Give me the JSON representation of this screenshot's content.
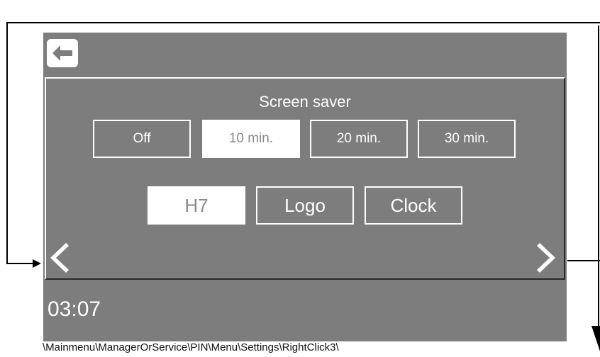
{
  "header": {
    "back_icon": "arrow-left-icon"
  },
  "panel": {
    "title": "Screen saver",
    "timer_options": [
      {
        "label": "Off",
        "selected": false
      },
      {
        "label": "10 min.",
        "selected": true
      },
      {
        "label": "20 min.",
        "selected": false
      },
      {
        "label": "30 min.",
        "selected": false
      }
    ],
    "mode_options": [
      {
        "label": "H7",
        "selected": true
      },
      {
        "label": "Logo",
        "selected": false
      },
      {
        "label": "Clock",
        "selected": false
      }
    ],
    "prev_icon": "chevron-left-icon",
    "next_icon": "chevron-right-icon"
  },
  "footer": {
    "time": "03:07"
  },
  "caption": {
    "path": "\\Mainmenu\\ManagerOrService\\PIN\\Menu\\Settings\\RightClick3\\"
  },
  "colors": {
    "screen_bg": "#7d7d7d",
    "accent": "#ffffff",
    "arrows": "#000000"
  }
}
